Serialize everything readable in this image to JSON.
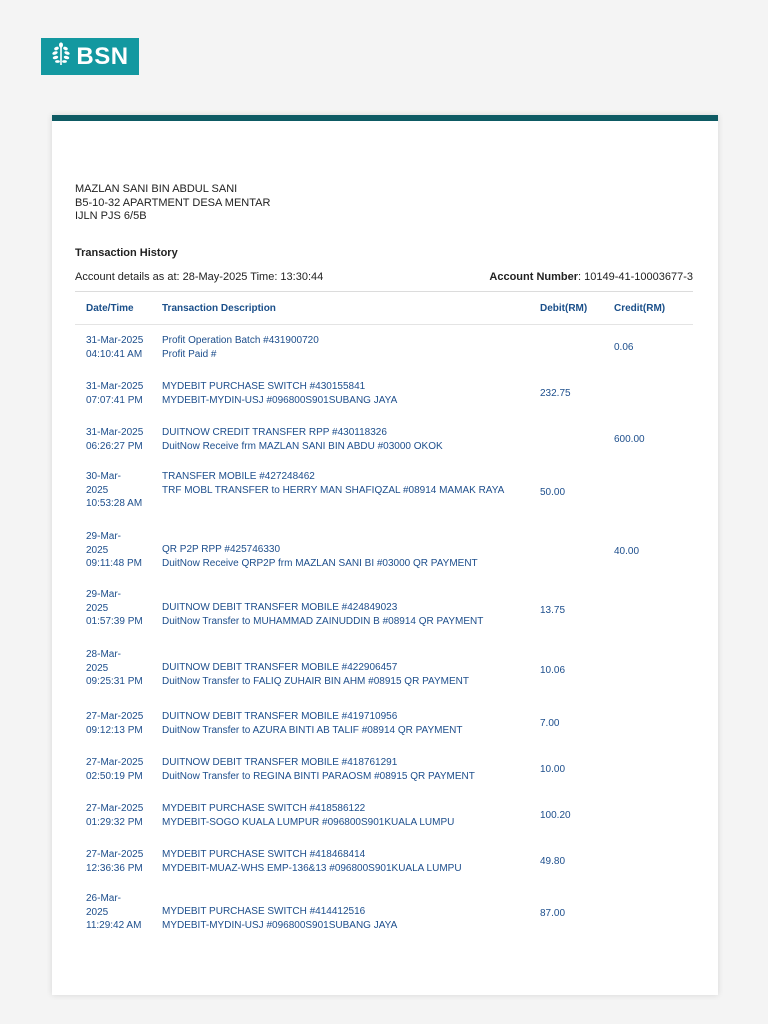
{
  "brand": {
    "name": "BSN",
    "logo_icon": "tree-icon",
    "color": "#1398a0",
    "bar_color": "#0d5a63"
  },
  "customer": {
    "name": "MAZLAN SANI BIN ABDUL SANI",
    "address_line1": "B5-10-32 APARTMENT DESA MENTAR",
    "address_line2": "IJLN PJS 6/5B"
  },
  "section_title": "Transaction History",
  "account": {
    "details_text": "Account details as at: 28-May-2025 Time: 13:30:44",
    "number_label": "Account Number",
    "number_value": ":  10149-41-10003677-3"
  },
  "table": {
    "headers": {
      "date": "Date/Time",
      "description": "Transaction Description",
      "debit": "Debit(RM)",
      "credit": "Credit(RM)"
    },
    "rows": [
      {
        "date": "31-Mar-2025\n04:10:41 AM",
        "desc1": "Profit Operation Batch #431900720",
        "desc2": "Profit Paid #",
        "debit": "",
        "credit": "0.06"
      },
      {
        "date": "31-Mar-2025\n07:07:41 PM",
        "desc1": "MYDEBIT PURCHASE SWITCH #430155841",
        "desc2": "MYDEBIT-MYDIN-USJ #096800S901SUBANG JAYA",
        "debit": "232.75",
        "credit": ""
      },
      {
        "date": "31-Mar-2025\n06:26:27 PM",
        "desc1": "DUITNOW CREDIT TRANSFER RPP #430118326",
        "desc2": "DuitNow Receive frm MAZLAN SANI BIN ABDU #03000 OKOK",
        "debit": "",
        "credit": "600.00"
      },
      {
        "date": "30-Mar-\n2025\n10:53:28 AM",
        "desc1": "TRANSFER MOBILE #427248462",
        "desc2": "TRF MOBL TRANSFER to HERRY MAN SHAFIQZAL #08914 MAMAK RAYA",
        "debit": "50.00",
        "credit": ""
      },
      {
        "date": "29-Mar-\n2025\n09:11:48 PM",
        "desc1": "QR P2P RPP #425746330",
        "desc2": "DuitNow Receive QRP2P frm MAZLAN SANI BI #03000 QR PAYMENT",
        "debit": "",
        "credit": "40.00"
      },
      {
        "date": "29-Mar-\n2025\n01:57:39 PM",
        "desc1": "DUITNOW DEBIT TRANSFER MOBILE #424849023",
        "desc2": "DuitNow Transfer to MUHAMMAD ZAINUDDIN B #08914 QR PAYMENT",
        "debit": "13.75",
        "credit": ""
      },
      {
        "date": "28-Mar-\n2025\n09:25:31 PM",
        "desc1": "DUITNOW DEBIT TRANSFER MOBILE #422906457",
        "desc2": "DuitNow Transfer to FALIQ ZUHAIR BIN AHM #08915 QR PAYMENT",
        "debit": "10.06",
        "credit": ""
      },
      {
        "date": "27-Mar-2025\n09:12:13 PM",
        "desc1": "DUITNOW DEBIT TRANSFER MOBILE #419710956",
        "desc2": "DuitNow Transfer to AZURA BINTI AB TALIF #08914 QR PAYMENT",
        "debit": "7.00",
        "credit": ""
      },
      {
        "date": "27-Mar-2025\n02:50:19 PM",
        "desc1": "DUITNOW DEBIT TRANSFER MOBILE #418761291",
        "desc2": "DuitNow Transfer to REGINA BINTI PARAOSM #08915 QR PAYMENT",
        "debit": "10.00",
        "credit": ""
      },
      {
        "date": "27-Mar-2025\n01:29:32 PM",
        "desc1": "MYDEBIT PURCHASE SWITCH #418586122",
        "desc2": "MYDEBIT-SOGO KUALA LUMPUR #096800S901KUALA LUMPU",
        "debit": "100.20",
        "credit": ""
      },
      {
        "date": "27-Mar-2025\n12:36:36 PM",
        "desc1": "MYDEBIT PURCHASE SWITCH #418468414",
        "desc2": "MYDEBIT-MUAZ-WHS EMP-136&13 #096800S901KUALA LUMPU",
        "debit": "49.80",
        "credit": ""
      },
      {
        "date": "26-Mar-\n2025\n11:29:42 AM",
        "desc1": "MYDEBIT PURCHASE SWITCH #414412516",
        "desc2": "MYDEBIT-MYDIN-USJ #096800S901SUBANG JAYA",
        "debit": "87.00",
        "credit": ""
      }
    ]
  }
}
